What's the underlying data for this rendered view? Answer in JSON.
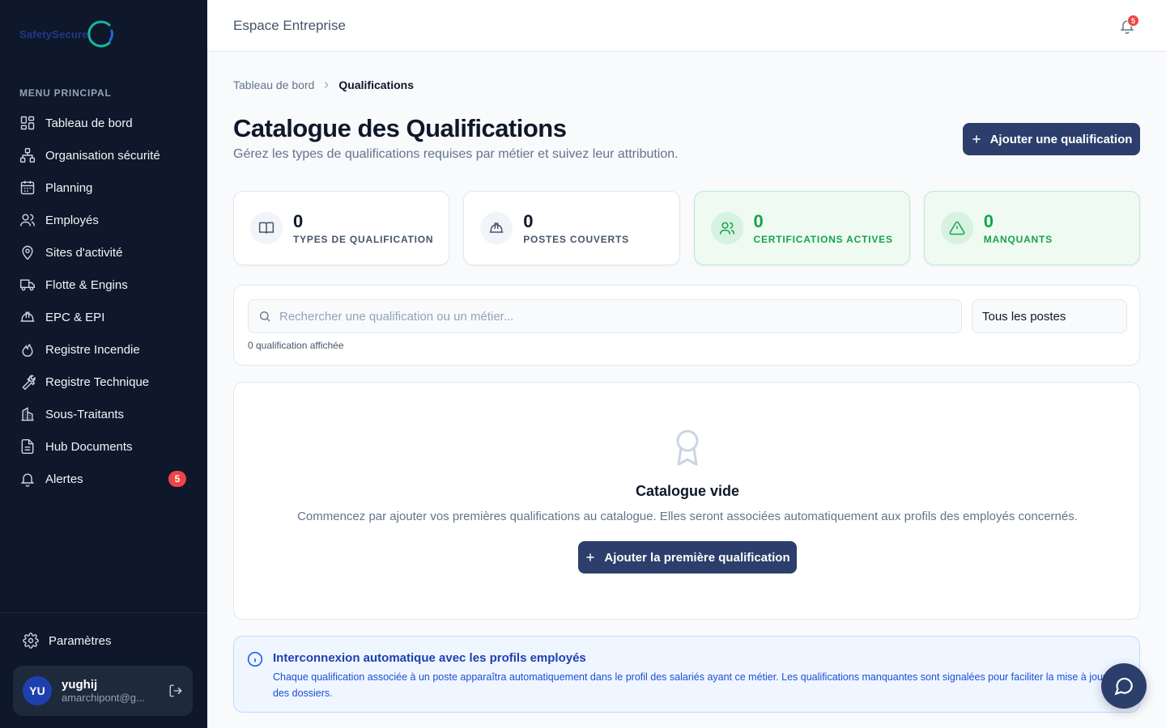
{
  "brand": {
    "logo_text": "SafetySecure",
    "accent_color": "#2c3e6b",
    "sidebar_bg": "#0f172a",
    "success_color": "#16a34a",
    "danger_color": "#ef4444"
  },
  "sidebar": {
    "menu_title": "MENU PRINCIPAL",
    "items": [
      {
        "label": "Tableau de bord",
        "icon": "dashboard-icon"
      },
      {
        "label": "Organisation sécurité",
        "icon": "org-chart-icon"
      },
      {
        "label": "Planning",
        "icon": "calendar-icon"
      },
      {
        "label": "Employés",
        "icon": "users-icon"
      },
      {
        "label": "Sites d'activité",
        "icon": "map-pin-icon"
      },
      {
        "label": "Flotte & Engins",
        "icon": "truck-icon"
      },
      {
        "label": "EPC & EPI",
        "icon": "hard-hat-icon"
      },
      {
        "label": "Registre Incendie",
        "icon": "flame-icon"
      },
      {
        "label": "Registre Technique",
        "icon": "wrench-icon"
      },
      {
        "label": "Sous-Traitants",
        "icon": "building-icon"
      },
      {
        "label": "Hub Documents",
        "icon": "document-icon"
      },
      {
        "label": "Alertes",
        "icon": "bell-icon",
        "badge": "5"
      }
    ],
    "settings_label": "Paramètres",
    "user": {
      "initials": "YU",
      "name": "yughij",
      "email": "amarchipont@g..."
    }
  },
  "header": {
    "title": "Espace Entreprise",
    "notification_count": "5"
  },
  "breadcrumb": {
    "parent": "Tableau de bord",
    "current": "Qualifications"
  },
  "page": {
    "title": "Catalogue des Qualifications",
    "subtitle": "Gérez les types de qualifications requises par métier et suivez leur attribution.",
    "add_button": "Ajouter une qualification"
  },
  "stats": [
    {
      "value": "0",
      "label": "TYPES DE QUALIFICATION",
      "icon": "book-icon",
      "tone": "neutral"
    },
    {
      "value": "0",
      "label": "POSTES COUVERTS",
      "icon": "hard-hat-icon",
      "tone": "neutral"
    },
    {
      "value": "0",
      "label": "CERTIFICATIONS ACTIVES",
      "icon": "users-icon",
      "tone": "green"
    },
    {
      "value": "0",
      "label": "MANQUANTS",
      "icon": "warning-icon",
      "tone": "green"
    }
  ],
  "filters": {
    "search_placeholder": "Rechercher une qualification ou un métier...",
    "search_value": "",
    "post_select": "Tous les postes",
    "result_count": "0 qualification affichée"
  },
  "empty_state": {
    "title": "Catalogue vide",
    "text": "Commencez par ajouter vos premières qualifications au catalogue. Elles seront associées automatiquement aux profils des employés concernés.",
    "button": "Ajouter la première qualification"
  },
  "info": {
    "title": "Interconnexion automatique avec les profils employés",
    "text": "Chaque qualification associée à un poste apparaîtra automatiquement dans le profil des salariés ayant ce métier. Les qualifications manquantes sont signalées pour faciliter la mise à jour des dossiers."
  }
}
